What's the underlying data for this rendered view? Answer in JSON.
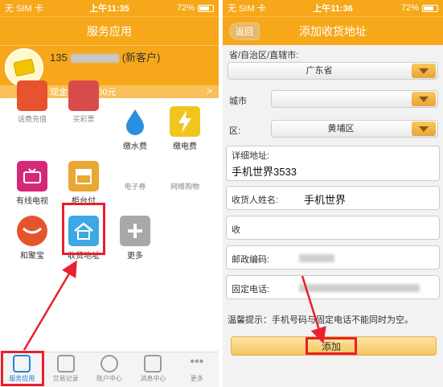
{
  "left": {
    "status": {
      "carrier": "无 SIM 卡",
      "time": "上午11:35",
      "battery": "72%",
      "battery_level": 0.72
    },
    "title": "服务应用",
    "account": {
      "phone_prefix": "135",
      "customer_tag": "(新客户)",
      "balance_label": "现金余额:",
      "balance_value": "0.00元",
      "more": ">"
    },
    "tiles": [
      {
        "label": "话费充值",
        "icon": "phone-topup-icon"
      },
      {
        "label": "买彩票",
        "icon": "lottery-icon"
      },
      {
        "label": "缴水费",
        "icon": "water-drop-icon"
      },
      {
        "label": "缴电费",
        "icon": "lightning-icon"
      },
      {
        "label": "有线电视",
        "icon": "tv-icon"
      },
      {
        "label": "柜台付",
        "icon": "counter-pay-icon"
      },
      {
        "label": "电子券",
        "icon": "coupon-icon"
      },
      {
        "label": "网络购物",
        "icon": "shopping-icon"
      },
      {
        "label": "和聚宝",
        "icon": "hejubao-icon"
      },
      {
        "label": "收货地址",
        "icon": "home-address-icon"
      },
      {
        "label": "更多",
        "icon": "plus-icon"
      }
    ],
    "tabs": [
      {
        "label": "服务应用",
        "icon": "service-app-icon"
      },
      {
        "label": "交易记录",
        "icon": "transaction-record-icon"
      },
      {
        "label": "账户中心",
        "icon": "account-center-icon"
      },
      {
        "label": "消息中心",
        "icon": "message-center-icon"
      },
      {
        "label": "更多",
        "icon": "more-dots-icon"
      }
    ],
    "colors": {
      "brand": "#f6a81a",
      "highlight": "#e8212e",
      "active_tab": "#1f86d8"
    }
  },
  "right": {
    "status": {
      "carrier": "无 SIM 卡",
      "time": "上午11:36",
      "battery": "72%",
      "battery_level": 0.72
    },
    "title": "添加收货地址",
    "back_label": "返回",
    "province_label": "省/自治区/直辖市:",
    "province_value": "广东省",
    "city_label": "城市",
    "city_value": "",
    "district_label": "区:",
    "district_value": "黄埔区",
    "address_label": "详细地址:",
    "address_value": "手机世界3533",
    "name_label": "收货人姓名:",
    "name_value": "手机世界",
    "mobile_label": "收",
    "postcode_label": "邮政编码:",
    "phone_label": "固定电话:",
    "hint": "温馨提示：手机号码与固定电话不能同时为空。",
    "submit_label": "添加"
  }
}
